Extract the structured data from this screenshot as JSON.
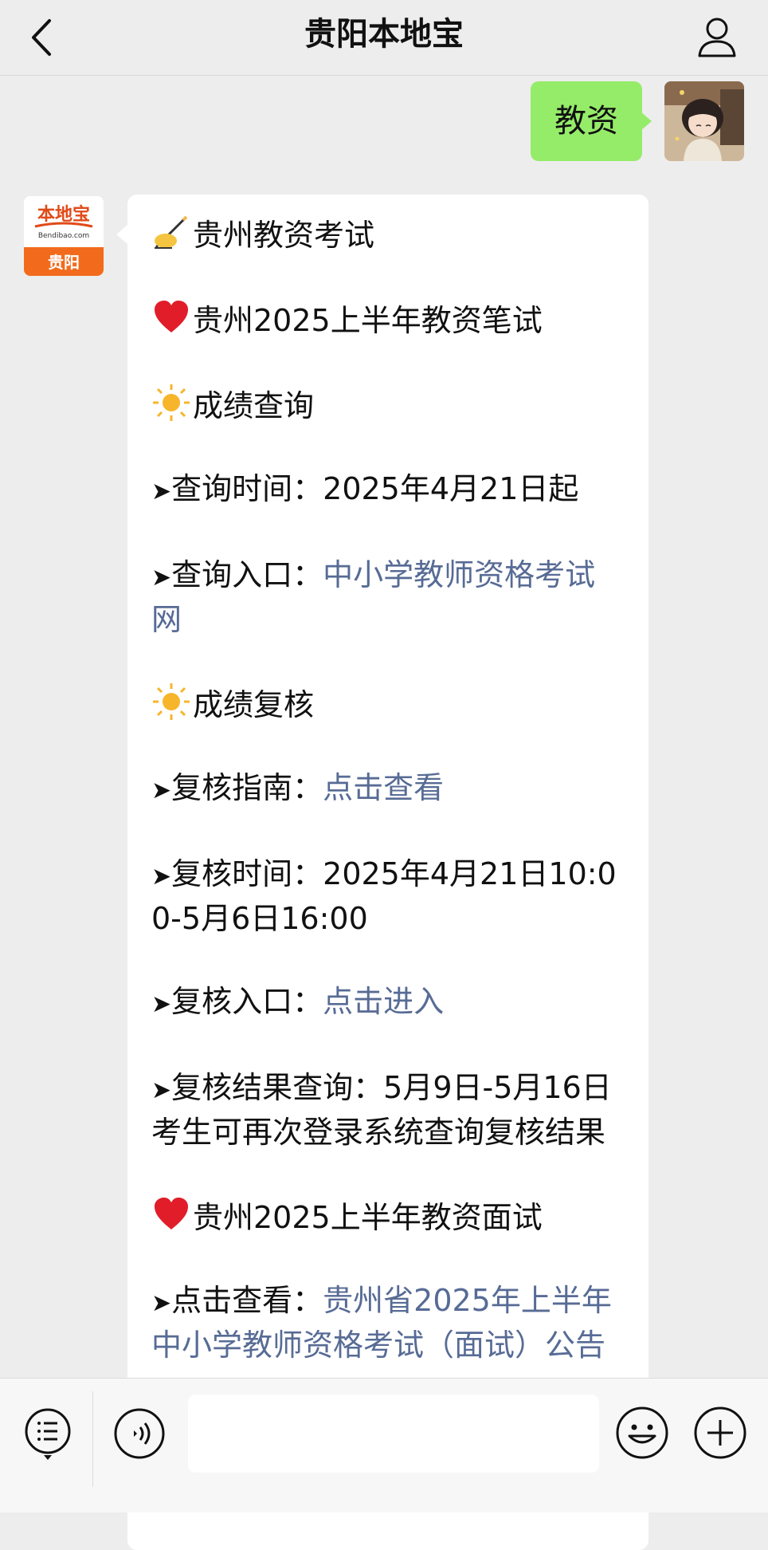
{
  "header": {
    "title": "贵阳本地宝"
  },
  "sent_message": {
    "text": "教资"
  },
  "bot": {
    "avatar_text_top": "本地宝",
    "avatar_text_url": "Bendibao.com",
    "avatar_text_city": "贵阳"
  },
  "message": {
    "l1": "贵州教资考试",
    "l2": "贵州2025上半年教资笔试",
    "l3": "成绩查询",
    "l4_label": "查询时间：",
    "l4_value": "2025年4月21日起",
    "l5_label": "查询入口：",
    "l5_link": "中小学教师资格考试网",
    "l6": "成绩复核",
    "l7_label": "复核指南：",
    "l7_link": "点击查看",
    "l8_label": "复核时间：",
    "l8_value": "2025年4月21日10:00-5月6日16:00",
    "l9_label": "复核入口：",
    "l9_link": "点击进入",
    "l10_label": "复核结果查询：",
    "l10_value": "5月9日-5月16日考生可再次登录系统查询复核结果",
    "l11": "贵州2025上半年教资面试",
    "l12_label": "点击查看：",
    "l12_link": "贵州省2025年上半年中小学教师资格考试（面试）公告"
  },
  "icons": {
    "back": "chevron-left-icon",
    "profile": "person-icon",
    "menu": "list-menu-icon",
    "voice": "voice-icon",
    "emoji": "smiley-icon",
    "plus": "plus-icon"
  },
  "colors": {
    "sent_bubble": "#95ec69",
    "link": "#576b95",
    "background": "#ededed"
  }
}
